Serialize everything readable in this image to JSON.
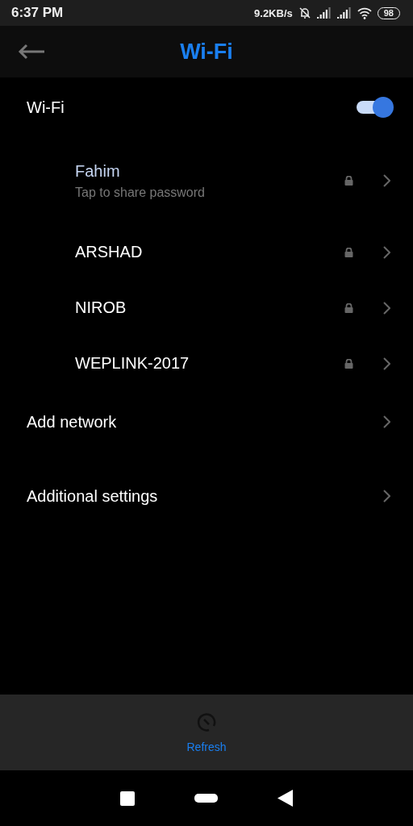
{
  "status_bar": {
    "time": "6:37 PM",
    "speed": "9.2KB/s",
    "battery": "98"
  },
  "header": {
    "title": "Wi-Fi"
  },
  "wifi_toggle": {
    "label": "Wi-Fi",
    "on": true
  },
  "networks": [
    {
      "name": "Fahim",
      "subtitle": "Tap to share password",
      "connected": true,
      "secured": true
    },
    {
      "name": "ARSHAD",
      "connected": false,
      "secured": true
    },
    {
      "name": "NIROB",
      "connected": false,
      "secured": true
    },
    {
      "name": "WEPLINK-2017",
      "connected": false,
      "secured": true
    }
  ],
  "menu_items": [
    "Add network",
    "Additional settings"
  ],
  "bottom_action": {
    "label": "Refresh"
  }
}
